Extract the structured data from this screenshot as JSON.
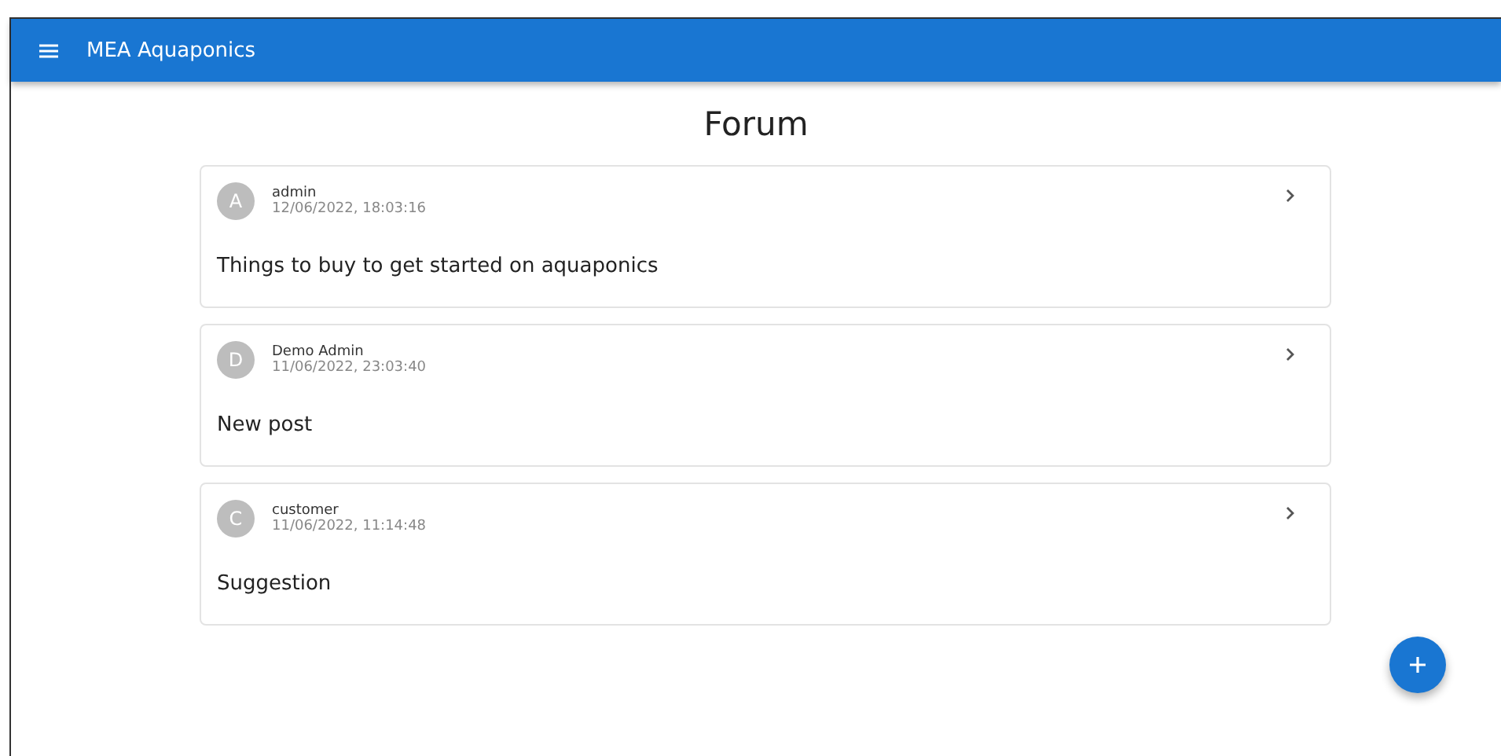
{
  "app_bar": {
    "title": "MEA Aquaponics"
  },
  "page_title": "Forum",
  "posts": [
    {
      "avatar": "A",
      "author": "admin",
      "date": "12/06/2022, 18:03:16",
      "title": "Things to buy to get started on aquaponics"
    },
    {
      "avatar": "D",
      "author": "Demo Admin",
      "date": "11/06/2022, 23:03:40",
      "title": "New post"
    },
    {
      "avatar": "C",
      "author": "customer",
      "date": "11/06/2022, 11:14:48",
      "title": "Suggestion"
    }
  ]
}
